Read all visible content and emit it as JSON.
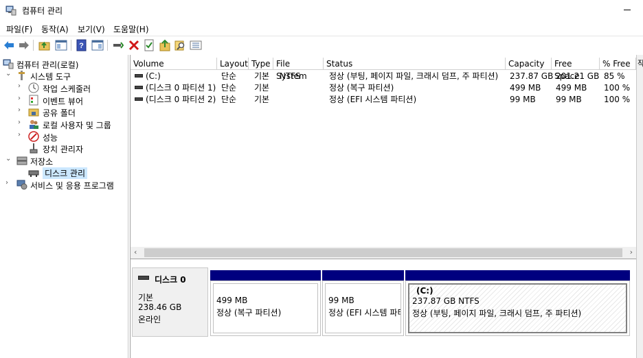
{
  "window": {
    "title": "컴퓨터 관리"
  },
  "menu": [
    "파일(F)",
    "동작(A)",
    "보기(V)",
    "도움말(H)"
  ],
  "toolbar": [
    "back-icon",
    "forward-icon",
    "up-folder-icon",
    "show-hide-tree-icon",
    "help-icon",
    "show-hide-action-pane-icon",
    "connect-icon",
    "delete-icon",
    "properties-icon",
    "export-icon",
    "search-icon",
    "list-icon"
  ],
  "tree": {
    "root": "컴퓨터 관리(로컬)",
    "system_tools": "시스템 도구",
    "task_scheduler": "작업 스케줄러",
    "event_viewer": "이벤트 뷰어",
    "shared_folders": "공유 폴더",
    "local_users": "로컬 사용자 및 그룹",
    "performance": "성능",
    "device_manager": "장치 관리자",
    "storage": "저장소",
    "disk_management": "디스크 관리",
    "services": "서비스 및 응용 프로그램"
  },
  "table": {
    "columns": [
      "Volume",
      "Layout",
      "Type",
      "File System",
      "Status",
      "Capacity",
      "Free Space",
      "% Free"
    ],
    "rows": [
      [
        "(C:)",
        "단순",
        "기본",
        "NTFS",
        "정상 (부팅, 페이지 파일, 크래시 덤프, 주 파티션)",
        "237.87 GB",
        "201.21 GB",
        "85 %"
      ],
      [
        "(디스크 0 파티션 1)",
        "단순",
        "기본",
        "",
        "정상 (복구 파티션)",
        "499 MB",
        "499 MB",
        "100 %"
      ],
      [
        "(디스크 0 파티션 2)",
        "단순",
        "기본",
        "",
        "정상 (EFI 시스템 파티션)",
        "99 MB",
        "99 MB",
        "100 %"
      ]
    ]
  },
  "disk": {
    "name": "디스크 0",
    "type": "기본",
    "size": "238.46 GB",
    "state": "온라인",
    "partitions": [
      {
        "label": "",
        "size": "499 MB",
        "status": "정상 (복구 파티션)"
      },
      {
        "label": "",
        "size": "99 MB",
        "status": "정상 (EFI 시스템 파티"
      },
      {
        "label": "(C:)",
        "size": "237.87 GB NTFS",
        "status": "정상 (부팅, 페이지 파일, 크래시 덤프, 주 파티션)"
      }
    ]
  },
  "right_edge_label": "작",
  "colors": {
    "partition_bar": "#00007f",
    "selection": "#cce8ff"
  }
}
